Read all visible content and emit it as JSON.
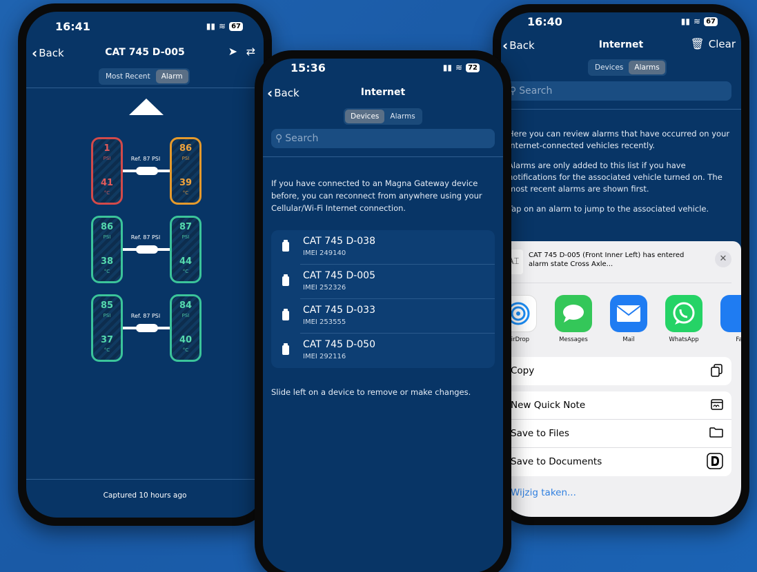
{
  "phone1": {
    "time": "16:41",
    "battery": "67",
    "back_label": "Back",
    "title": "CAT 745 D-005",
    "tabs": [
      "Most Recent",
      "Alarm"
    ],
    "active_tab": "Alarm",
    "axles": [
      {
        "ref": "Ref. 87 PSI",
        "left": {
          "psi": "1",
          "temp": "41",
          "status": "red"
        },
        "right": {
          "psi": "86",
          "temp": "39",
          "status": "orange"
        }
      },
      {
        "ref": "Ref. 87 PSI",
        "left": {
          "psi": "86",
          "temp": "38",
          "status": "green"
        },
        "right": {
          "psi": "87",
          "temp": "44",
          "status": "green"
        }
      },
      {
        "ref": "Ref. 87 PSI",
        "left": {
          "psi": "85",
          "temp": "37",
          "status": "green"
        },
        "right": {
          "psi": "84",
          "temp": "40",
          "status": "green"
        }
      }
    ],
    "unit_pressure": "PSI",
    "unit_temp": "°C",
    "footer": "Captured 10 hours ago"
  },
  "phone2": {
    "time": "15:36",
    "battery": "72",
    "back_label": "Back",
    "title": "Internet",
    "tabs": [
      "Devices",
      "Alarms"
    ],
    "active_tab": "Devices",
    "search_placeholder": "Search",
    "intro": "If you have connected to an Magna Gateway device before, you can reconnect from anywhere using your Cellular/Wi-Fi Internet connection.",
    "devices": [
      {
        "name": "CAT 745 D-038",
        "imei": "IMEI 249140"
      },
      {
        "name": "CAT 745 D-005",
        "imei": "IMEI 252326"
      },
      {
        "name": "CAT 745 D-033",
        "imei": "IMEI 253555"
      },
      {
        "name": "CAT 745 D-050",
        "imei": "IMEI 292116"
      }
    ],
    "hint": "Slide left on a device to remove or make changes."
  },
  "phone3": {
    "time": "16:40",
    "battery": "67",
    "back_label": "Back",
    "title": "Internet",
    "clear_label": "Clear",
    "tabs": [
      "Devices",
      "Alarms"
    ],
    "active_tab": "Alarms",
    "search_placeholder": "Search",
    "para1": "Here you can review alarms that have occurred on your Internet-connected vehicles recently.",
    "para2": "Alarms are only added to this list if you have notifications for the associated vehicle turned on. The most recent alarms are shown first.",
    "para3": "Tap on an alarm to jump to the associated vehicle.",
    "share": {
      "preview_text": "CAT 745 D-005 (Front Inner Left) has entered alarm state Cross Axle...",
      "apps": [
        {
          "label": "AirDrop",
          "icon": "airdrop-icon",
          "color": "#ffffff"
        },
        {
          "label": "Messages",
          "icon": "messages-icon",
          "color": "#34c759"
        },
        {
          "label": "Mail",
          "icon": "mail-icon",
          "color": "#1f7cf2"
        },
        {
          "label": "WhatsApp",
          "icon": "whatsapp-icon",
          "color": "#25d366"
        },
        {
          "label": "Fa",
          "icon": "facetime-icon",
          "color": "#1f7cf2"
        }
      ],
      "copy_label": "Copy",
      "actions": [
        "New Quick Note",
        "Save to Files",
        "Save to Documents"
      ],
      "edit_actions": "Wijzig taken..."
    }
  }
}
